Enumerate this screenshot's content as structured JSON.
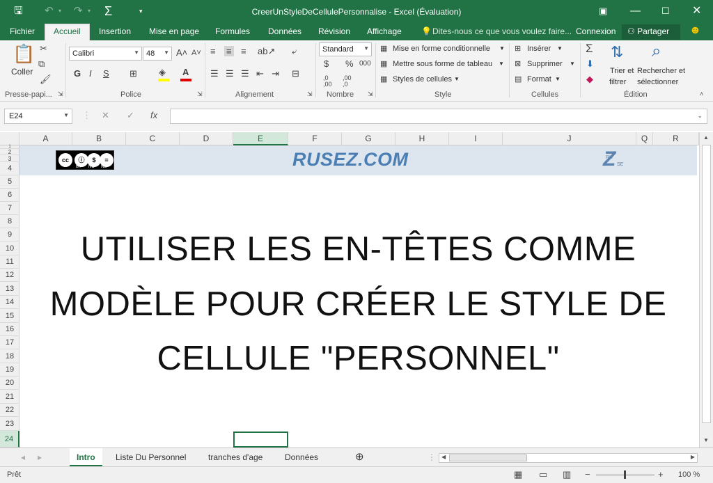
{
  "window": {
    "title": "CreerUnStyleDeCellulePersonnalise - Excel (Évaluation)"
  },
  "tabs": {
    "items": [
      "Fichier",
      "Accueil",
      "Insertion",
      "Mise en page",
      "Formules",
      "Données",
      "Révision",
      "Affichage"
    ],
    "tell_me": "Dites-nous ce que vous voulez faire...",
    "login": "Connexion",
    "share": "Partager"
  },
  "ribbon": {
    "clipboard": {
      "paste": "Coller",
      "label": "Presse-papi..."
    },
    "font": {
      "name": "Calibri",
      "size": "48",
      "bold": "G",
      "italic": "I",
      "underline": "S",
      "label": "Police"
    },
    "alignment": {
      "label": "Alignement"
    },
    "number": {
      "format": "Standard",
      "currency": "$",
      "percent": "%",
      "thousands": "000",
      "dec_inc": ",0\n,00",
      "dec_dec": ",00\n,0",
      "label": "Nombre"
    },
    "style": {
      "conditional": "Mise en forme conditionnelle",
      "as_table": "Mettre sous forme de tableau",
      "cell_styles": "Styles de cellules",
      "label": "Style"
    },
    "cells": {
      "insert": "Insérer",
      "delete": "Supprimer",
      "format": "Format",
      "label": "Cellules"
    },
    "editing": {
      "sort1": "Trier et",
      "sort2": "filtrer",
      "find1": "Rechercher et",
      "find2": "sélectionner",
      "label": "Édition"
    }
  },
  "formula_bar": {
    "name_box": "E24",
    "fx": "fx",
    "value": ""
  },
  "columns": [
    "A",
    "B",
    "C",
    "D",
    "E",
    "F",
    "G",
    "H",
    "I",
    "J",
    "Q",
    "R"
  ],
  "rows": [
    "1",
    "2",
    "3",
    "4",
    "5",
    "6",
    "7",
    "8",
    "9",
    "10",
    "11",
    "12",
    "13",
    "14",
    "15",
    "16",
    "17",
    "18",
    "19",
    "20",
    "21",
    "22",
    "23",
    "24"
  ],
  "sheet": {
    "brand": "RUSEZ.COM",
    "cc_labels": [
      "BY",
      "NC",
      "ND"
    ],
    "logo_letter": "Z",
    "logo_ru": "RU",
    "logo_se": "SE",
    "lines": [
      "UTILISER LES EN-TÊTES COMME",
      "MODÈLE POUR CRÉER LE STYLE DE",
      "CELLULE \"PERSONNEL\""
    ]
  },
  "sheet_tabs": [
    "Intro",
    "Liste Du Personnel",
    "tranches d'age",
    "Données"
  ],
  "status": {
    "ready": "Prêt",
    "zoom": "100 %"
  }
}
